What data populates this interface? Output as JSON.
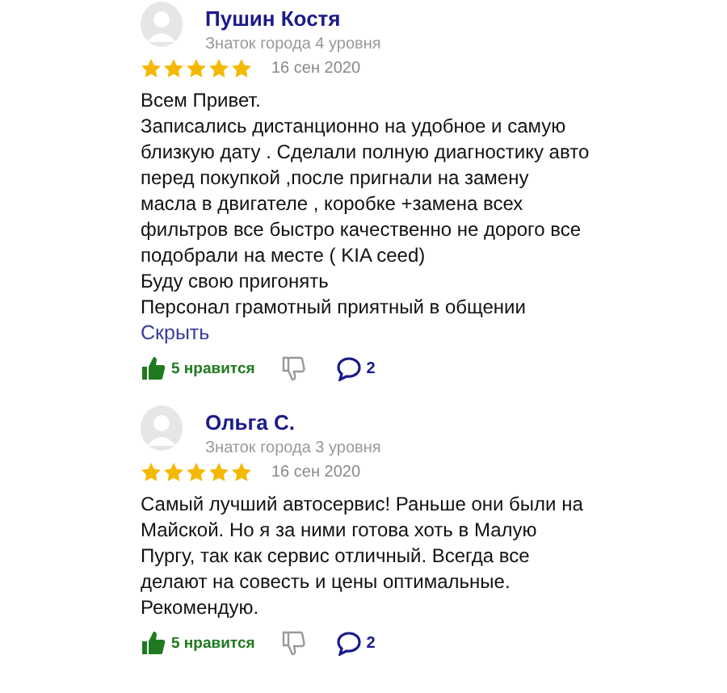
{
  "reviews": [
    {
      "author": "Пушин Костя",
      "level": "Знаток города 4 уровня",
      "stars": 5,
      "date": "16 сен 2020",
      "lines": [
        "Всем Привет.",
        "Записались дистанционно на удобное и самую",
        "близкую дату . Сделали полную диагностику авто",
        "перед покупкой ,после пригнали на замену",
        "масла в двигателе , коробке +замена всех",
        "фильтров все быстро качественно не дорого все",
        "подобрали на месте ( KIA ceed)",
        "Буду свою пригонять",
        "Персонал грамотный приятный в общении"
      ],
      "toggle": "Скрыть",
      "likes": "5 нравится",
      "liked": true,
      "comments": "2"
    },
    {
      "author": "Ольга С.",
      "level": "Знаток города 3 уровня",
      "stars": 5,
      "date": "16 сен 2020",
      "lines": [
        "Самый лучший автосервис! Раньше они были на",
        "Майской. Но я за ними готова хоть в Малую",
        "Пургу, так как сервис отличный. Всегда все",
        "делают на совесть и цены оптимальные.",
        "Рекомендую."
      ],
      "likes": "5 нравится",
      "liked": true,
      "comments": "2"
    }
  ]
}
